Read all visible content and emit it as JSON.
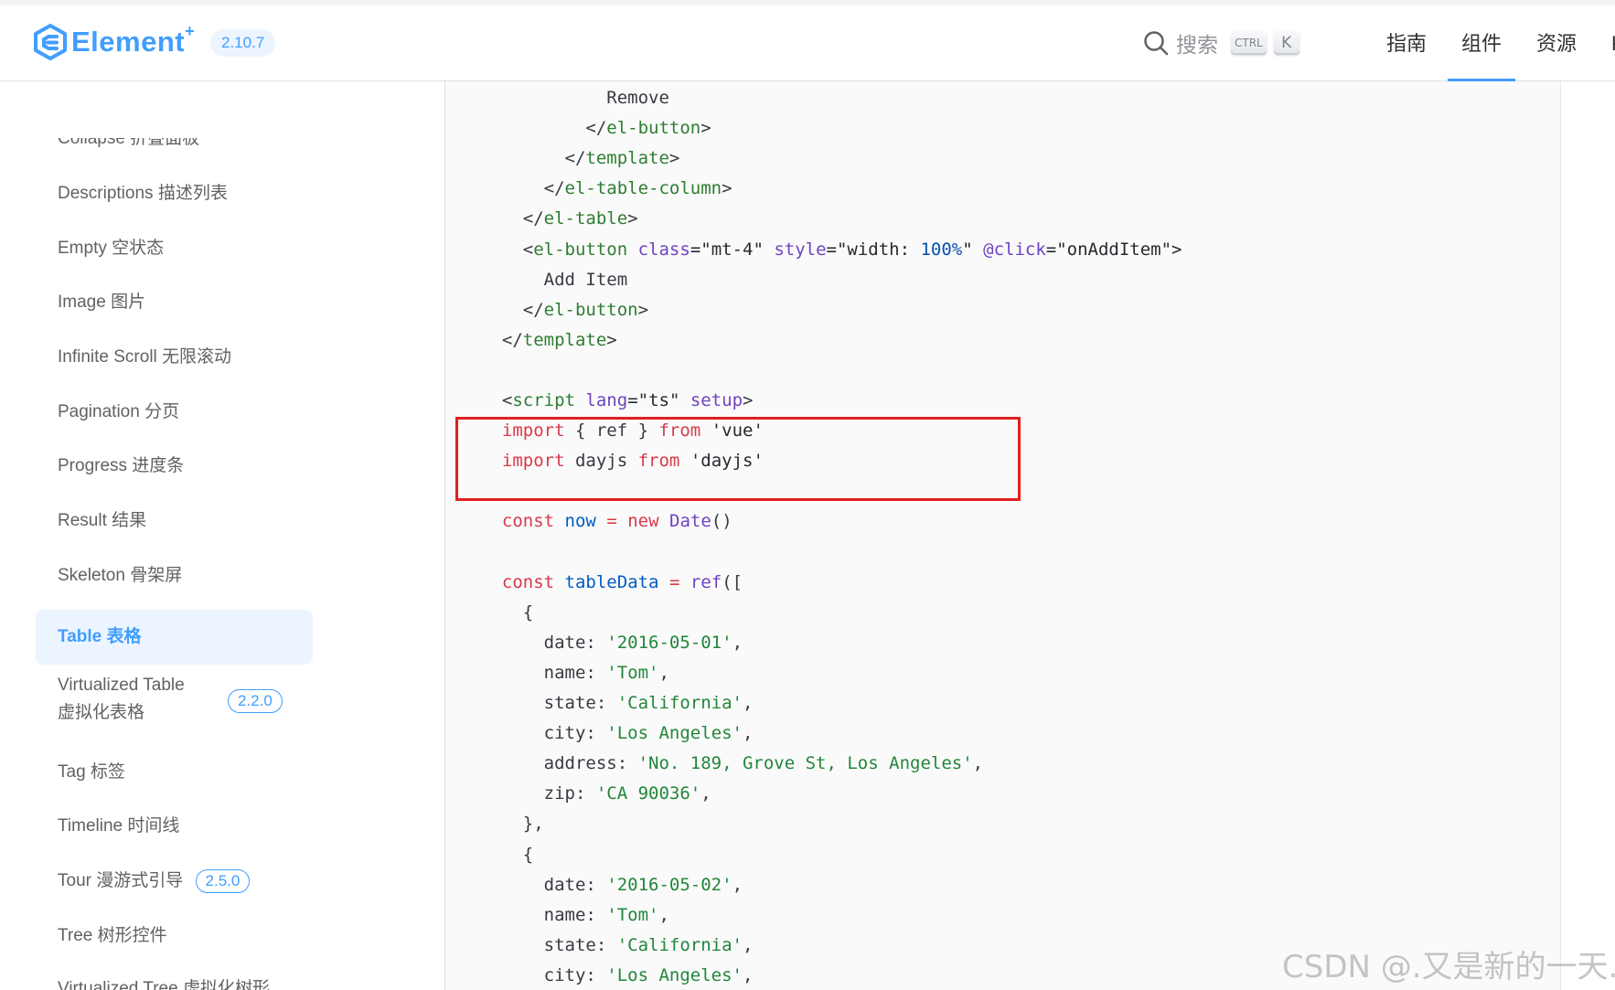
{
  "header": {
    "logo_text": "Element",
    "logo_plus": "+",
    "version": "2.10.7",
    "search_label": "搜索",
    "kbd_ctrl": "CTRL",
    "kbd_k": "K",
    "nav": [
      {
        "label": "指南",
        "active": false
      },
      {
        "label": "组件",
        "active": true
      },
      {
        "label": "资源",
        "active": false
      },
      {
        "label": "Play",
        "active": false
      }
    ]
  },
  "sidebar": {
    "items": [
      {
        "label": "Collapse 折叠面板"
      },
      {
        "label": "Descriptions 描述列表"
      },
      {
        "label": "Empty 空状态"
      },
      {
        "label": "Image 图片"
      },
      {
        "label": "Infinite Scroll 无限滚动"
      },
      {
        "label": "Pagination 分页"
      },
      {
        "label": "Progress 进度条"
      },
      {
        "label": "Result 结果"
      },
      {
        "label": "Skeleton 骨架屏"
      },
      {
        "label": "Table 表格",
        "active": true
      },
      {
        "label_line1": "Virtualized Table",
        "label_line2": "虚拟化表格",
        "badge": "2.2.0"
      },
      {
        "label": "Tag 标签"
      },
      {
        "label": "Timeline 时间线"
      },
      {
        "label": "Tour 漫游式引导",
        "badge": "2.5.0"
      },
      {
        "label": "Tree 树形控件"
      },
      {
        "label": "Virtualized Tree 虚拟化树形"
      }
    ]
  },
  "code": {
    "lines": [
      [
        {
          "t": "            Remove",
          "c": "p"
        }
      ],
      [
        {
          "t": "          </",
          "c": "p"
        },
        {
          "t": "el-button",
          "c": "tag"
        },
        {
          "t": ">",
          "c": "p"
        }
      ],
      [
        {
          "t": "        </",
          "c": "p"
        },
        {
          "t": "template",
          "c": "tag"
        },
        {
          "t": ">",
          "c": "p"
        }
      ],
      [
        {
          "t": "      </",
          "c": "p"
        },
        {
          "t": "el-table-column",
          "c": "tag"
        },
        {
          "t": ">",
          "c": "p"
        }
      ],
      [
        {
          "t": "    </",
          "c": "p"
        },
        {
          "t": "el-table",
          "c": "tag"
        },
        {
          "t": ">",
          "c": "p"
        }
      ],
      [
        {
          "t": "    <",
          "c": "p"
        },
        {
          "t": "el-button",
          "c": "tag"
        },
        {
          "t": " ",
          "c": "p"
        },
        {
          "t": "class",
          "c": "attr"
        },
        {
          "t": "=\"mt-4\" ",
          "c": "str"
        },
        {
          "t": "style",
          "c": "attr"
        },
        {
          "t": "=\"width: ",
          "c": "str"
        },
        {
          "t": "100%",
          "c": "num"
        },
        {
          "t": "\" ",
          "c": "str"
        },
        {
          "t": "@click",
          "c": "attr"
        },
        {
          "t": "=\"onAddItem\">",
          "c": "str"
        }
      ],
      [
        {
          "t": "      Add Item",
          "c": "p"
        }
      ],
      [
        {
          "t": "    </",
          "c": "p"
        },
        {
          "t": "el-button",
          "c": "tag"
        },
        {
          "t": ">",
          "c": "p"
        }
      ],
      [
        {
          "t": "  </",
          "c": "p"
        },
        {
          "t": "template",
          "c": "tag"
        },
        {
          "t": ">",
          "c": "p"
        }
      ],
      [
        {
          "t": "",
          "c": "p"
        }
      ],
      [
        {
          "t": "  <",
          "c": "p"
        },
        {
          "t": "script",
          "c": "tag"
        },
        {
          "t": " ",
          "c": "p"
        },
        {
          "t": "lang",
          "c": "attr"
        },
        {
          "t": "=\"ts\" ",
          "c": "str"
        },
        {
          "t": "setup",
          "c": "attr"
        },
        {
          "t": ">",
          "c": "p"
        }
      ],
      [
        {
          "t": "  ",
          "c": "p"
        },
        {
          "t": "import",
          "c": "kw"
        },
        {
          "t": " { ref } ",
          "c": "p"
        },
        {
          "t": "from",
          "c": "kw"
        },
        {
          "t": " 'vue'",
          "c": "str"
        }
      ],
      [
        {
          "t": "  ",
          "c": "p"
        },
        {
          "t": "import",
          "c": "kw"
        },
        {
          "t": " dayjs ",
          "c": "p"
        },
        {
          "t": "from",
          "c": "kw"
        },
        {
          "t": " 'dayjs'",
          "c": "str"
        }
      ],
      [
        {
          "t": "",
          "c": "p"
        }
      ],
      [
        {
          "t": "  ",
          "c": "p"
        },
        {
          "t": "const",
          "c": "kw"
        },
        {
          "t": " ",
          "c": "p"
        },
        {
          "t": "now",
          "c": "var"
        },
        {
          "t": " ",
          "c": "p"
        },
        {
          "t": "=",
          "c": "kw"
        },
        {
          "t": " ",
          "c": "p"
        },
        {
          "t": "new",
          "c": "kw"
        },
        {
          "t": " ",
          "c": "p"
        },
        {
          "t": "Date",
          "c": "fn"
        },
        {
          "t": "()",
          "c": "p"
        }
      ],
      [
        {
          "t": "",
          "c": "p"
        }
      ],
      [
        {
          "t": "  ",
          "c": "p"
        },
        {
          "t": "const",
          "c": "kw"
        },
        {
          "t": " ",
          "c": "p"
        },
        {
          "t": "tableData",
          "c": "var"
        },
        {
          "t": " ",
          "c": "p"
        },
        {
          "t": "=",
          "c": "kw"
        },
        {
          "t": " ",
          "c": "p"
        },
        {
          "t": "ref",
          "c": "fn"
        },
        {
          "t": "([",
          "c": "p"
        }
      ],
      [
        {
          "t": "    {",
          "c": "p"
        }
      ],
      [
        {
          "t": "      date: ",
          "c": "p"
        },
        {
          "t": "'2016-05-01'",
          "c": "sq"
        },
        {
          "t": ",",
          "c": "p"
        }
      ],
      [
        {
          "t": "      name: ",
          "c": "p"
        },
        {
          "t": "'Tom'",
          "c": "sq"
        },
        {
          "t": ",",
          "c": "p"
        }
      ],
      [
        {
          "t": "      state: ",
          "c": "p"
        },
        {
          "t": "'California'",
          "c": "sq"
        },
        {
          "t": ",",
          "c": "p"
        }
      ],
      [
        {
          "t": "      city: ",
          "c": "p"
        },
        {
          "t": "'Los Angeles'",
          "c": "sq"
        },
        {
          "t": ",",
          "c": "p"
        }
      ],
      [
        {
          "t": "      address: ",
          "c": "p"
        },
        {
          "t": "'No. 189, Grove St, Los Angeles'",
          "c": "sq"
        },
        {
          "t": ",",
          "c": "p"
        }
      ],
      [
        {
          "t": "      zip: ",
          "c": "p"
        },
        {
          "t": "'CA 90036'",
          "c": "sq"
        },
        {
          "t": ",",
          "c": "p"
        }
      ],
      [
        {
          "t": "    },",
          "c": "p"
        }
      ],
      [
        {
          "t": "    {",
          "c": "p"
        }
      ],
      [
        {
          "t": "      date: ",
          "c": "p"
        },
        {
          "t": "'2016-05-02'",
          "c": "sq"
        },
        {
          "t": ",",
          "c": "p"
        }
      ],
      [
        {
          "t": "      name: ",
          "c": "p"
        },
        {
          "t": "'Tom'",
          "c": "sq"
        },
        {
          "t": ",",
          "c": "p"
        }
      ],
      [
        {
          "t": "      state: ",
          "c": "p"
        },
        {
          "t": "'California'",
          "c": "sq"
        },
        {
          "t": ",",
          "c": "p"
        }
      ],
      [
        {
          "t": "      city: ",
          "c": "p"
        },
        {
          "t": "'Los Angeles'",
          "c": "sq"
        },
        {
          "t": ",",
          "c": "p"
        }
      ]
    ]
  },
  "watermark": "CSDN @.又是新的一天.",
  "colors": {
    "accent": "#409eff",
    "highlight_border": "#e02020"
  }
}
